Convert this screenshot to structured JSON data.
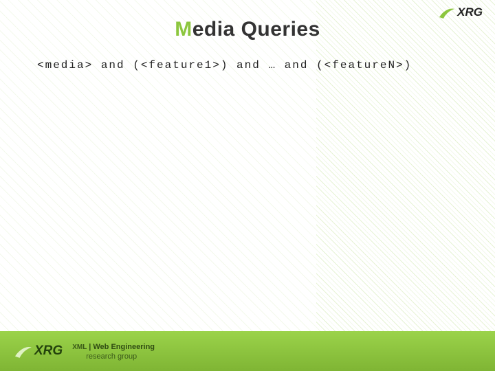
{
  "brand": {
    "name": "XRG",
    "swoosh_color_top": "#8CC63E",
    "swoosh_color_footer": "#345c12",
    "text_color_top": "#222",
    "text_color_footer": "#2c4710"
  },
  "title": {
    "accent_word": "M",
    "rest": "edia Queries"
  },
  "code": "<media> and (<feature1>) and … and (<featureN>)",
  "footer": {
    "line1_prefix": "XML",
    "line1_main": "Web Engineering",
    "line2": "research group"
  },
  "colors": {
    "accent": "#8CC63E",
    "footer_top": "#9bd34a",
    "footer_bottom": "#7fb534"
  }
}
